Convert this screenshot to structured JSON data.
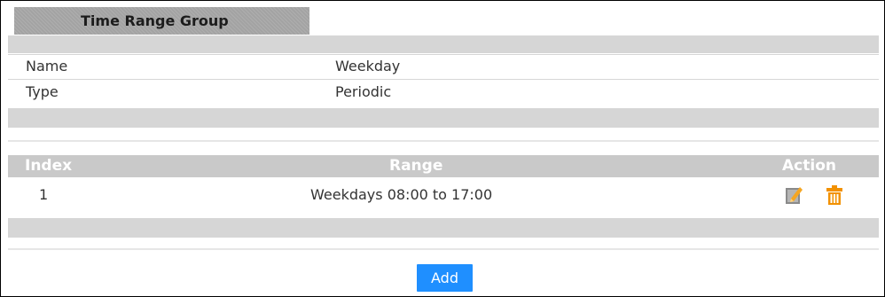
{
  "group": {
    "title": "Time Range Group"
  },
  "details": {
    "name_label": "Name",
    "name_value": "Weekday",
    "type_label": "Type",
    "type_value": "Periodic"
  },
  "table": {
    "headers": {
      "index": "Index",
      "range": "Range",
      "action": "Action"
    },
    "rows": [
      {
        "index": "1",
        "range": "Weekdays 08:00 to 17:00",
        "actions": [
          "edit-icon",
          "delete-icon"
        ]
      }
    ]
  },
  "buttons": {
    "add_label": "Add"
  },
  "colors": {
    "accent": "#1f8fff",
    "edit_icon": "#f5a623",
    "delete_icon": "#f29100",
    "header_bg": "#c9c9c9"
  }
}
